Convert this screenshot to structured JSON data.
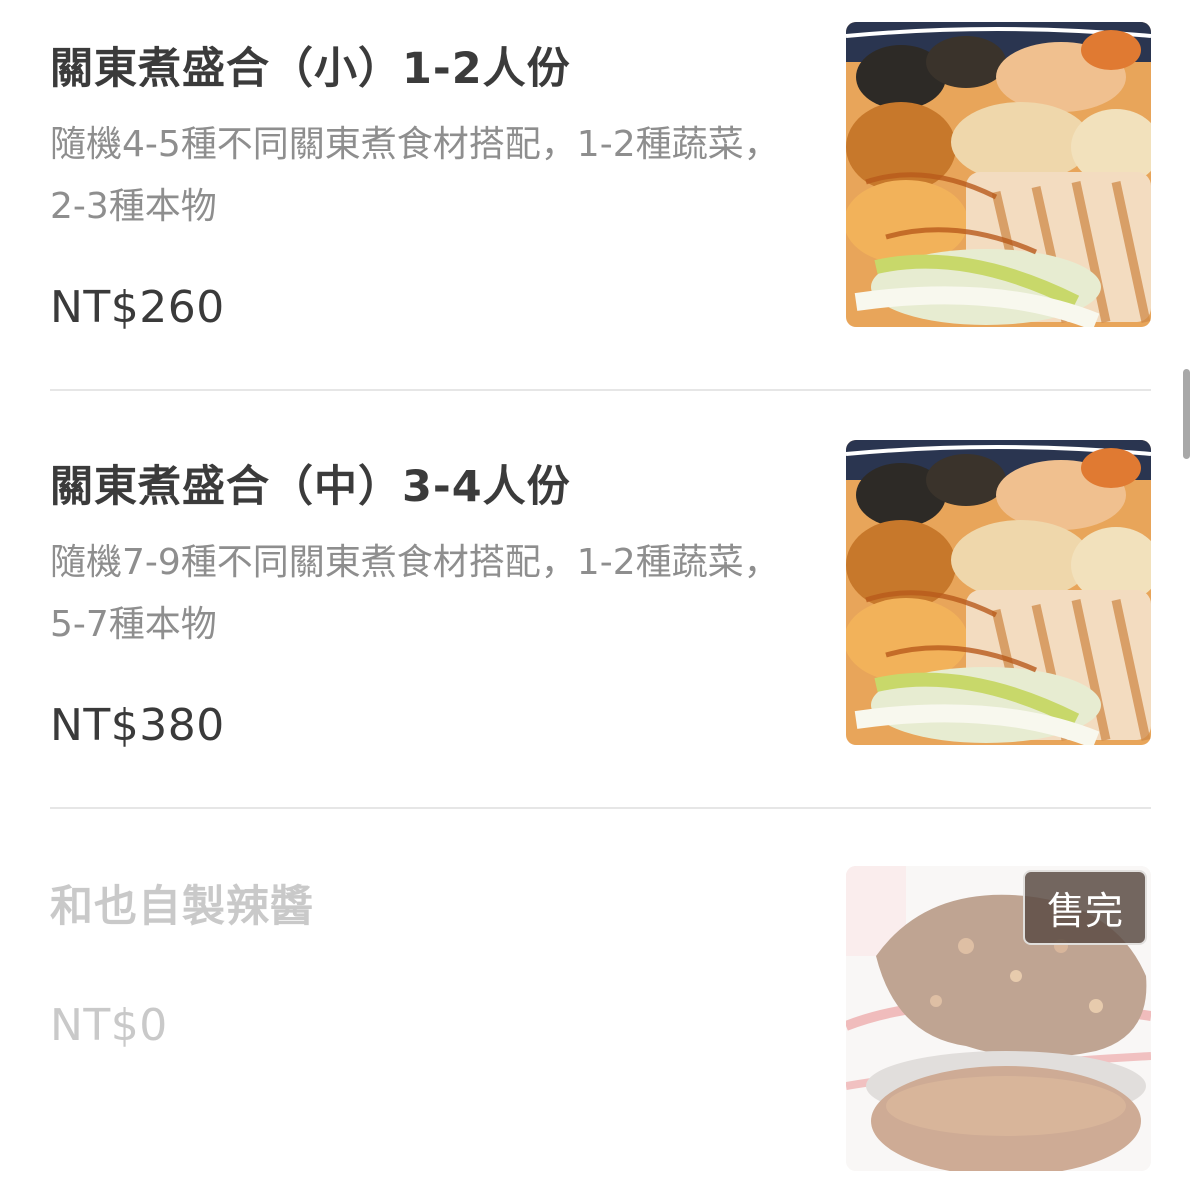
{
  "menu": {
    "items": [
      {
        "name": "關東煮盛合（小）1-2人份",
        "description": "隨機4-5種不同關東煮食材搭配，1-2種蔬菜，2-3種本物",
        "price": "NT$260",
        "image": "oden-bowl-photo"
      },
      {
        "name": "關東煮盛合（中）3-4人份",
        "description": "隨機7-9種不同關東煮食材搭配，1-2種蔬菜，5-7種本物",
        "price": "NT$380",
        "image": "oden-bowl-photo"
      },
      {
        "name": "和也自製辣醬",
        "price": "NT$0",
        "badge": "售完",
        "image": "chili-sauce-photo",
        "sold_out": true
      }
    ]
  },
  "colors": {
    "title": "#3b3b3b",
    "description": "#8e8e8e",
    "price": "#3a3a3a",
    "soldout_text": "#c9c9c9",
    "divider": "#e6e6e6",
    "badge_bg": "#5c4c44"
  }
}
